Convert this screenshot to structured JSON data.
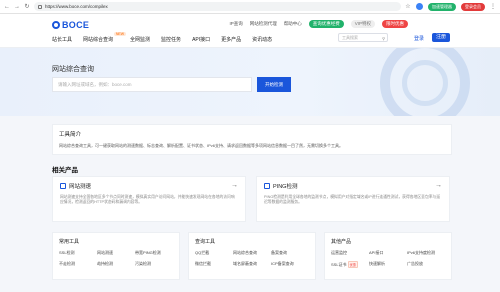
{
  "browser": {
    "url": "https://www.boce.com/compilex",
    "ext_green": "加速管理器",
    "ext_red": "登录会员"
  },
  "header": {
    "logo": "BOCE",
    "top_links": [
      "IP查询",
      "网站检测代理",
      "帮助中心"
    ],
    "pill_green": "查询优惠经费",
    "pill_grey": "VIP特权",
    "pill_red": "限时优惠",
    "menu": [
      "站长工具",
      "网站综合查询",
      "全网监测",
      "监控任务",
      "API接口",
      "更多产品",
      "资讯动态"
    ],
    "new_badge": "NEW",
    "search_placeholder": "工具搜索",
    "login": "登录",
    "register": "注册"
  },
  "hero": {
    "title": "网站综合查询",
    "input_placeholder": "请输入网址或域名，例如：boce.com",
    "button": "开始检测"
  },
  "intro": {
    "title": "工具简介",
    "text": "网站综合查询工具，可一键获取网站的测速数据、标志查询、解析配置、证书状态、IPv6支持、请求返回数据等多项网站信息数据一目了然，无需切换多个工具。"
  },
  "related": {
    "title": "相关产品",
    "cards": [
      {
        "title": "网站测速",
        "desc": "网站测速支持全国各地区多个节点同时测速，模拟真实用户访问网站，并能快速发现网站在各地的访问响应情况，检测返回的HTTP状态码和漏调内容等。"
      },
      {
        "title": "PING检测",
        "desc": "PING检测是利用全球各地的监测节点，模拟用户对指定域名或IP进行连通性测试，获得各地区丢包率与延迟等数据的监测服务。"
      }
    ]
  },
  "tools": [
    {
      "title": "常用工具",
      "items": [
        "SSL检测",
        "网站测速",
        "带宽PING检测",
        "不走检测",
        "劫持检测",
        "污染检测"
      ]
    },
    {
      "title": "查询工具",
      "items": [
        "QQ拦截",
        "网站综合查询",
        "备案查询",
        "微信拦截",
        "域名屏蔽查询",
        "ICP备案查询"
      ]
    },
    {
      "title": "其他产品",
      "items": [
        "运营监控",
        "API接口",
        "IPv6支持度检测",
        "SSL证书",
        "快速解析",
        "广告投放"
      ],
      "hot_label": "优惠"
    }
  ]
}
